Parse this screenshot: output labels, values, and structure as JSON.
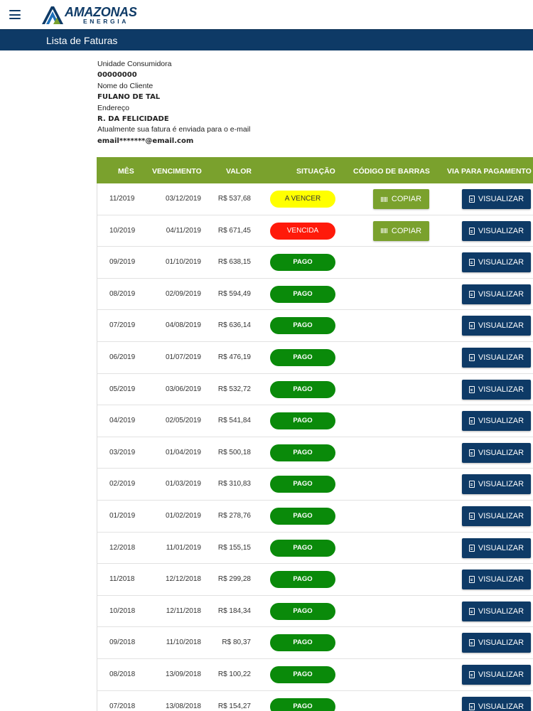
{
  "header": {
    "logo_name": "AMAZONAS",
    "logo_sub": "ENERGIA",
    "page_title": "Lista de Faturas"
  },
  "info": {
    "uc_label": "Unidade Consumidora",
    "uc_value": "00000000",
    "client_label": "Nome do Cliente",
    "client_value": "FULANO DE TAL",
    "address_label": "Endereço",
    "address_value": "R. DA FELICIDADE",
    "email_label": "Atualmente sua fatura é enviada para o e-mail",
    "email_value": "email*******@email.com"
  },
  "table": {
    "headers": {
      "mes": "MÊS",
      "vencimento": "VENCIMENTO",
      "valor": "VALOR",
      "situacao": "SITUAÇÃO",
      "codigo": "CÓDIGO DE BARRAS",
      "via": "VIA PARA PAGAMENTO"
    },
    "copy_label": "COPIAR",
    "view_label": "VISUALIZAR",
    "colors": {
      "header_bg": "#7aa12d",
      "navy": "#0e3a66",
      "paid": "#0a8a0a",
      "due": "#ffff00",
      "overdue": "#ff1a0a"
    },
    "rows": [
      {
        "mes": "11/2019",
        "vencimento": "03/12/2019",
        "valor": "R$ 537,68",
        "situacao": "A VENCER",
        "status": "vencer"
      },
      {
        "mes": "10/2019",
        "vencimento": "04/11/2019",
        "valor": "R$ 671,45",
        "situacao": "VENCIDA",
        "status": "vencida"
      },
      {
        "mes": "09/2019",
        "vencimento": "01/10/2019",
        "valor": "R$ 638,15",
        "situacao": "PAGO",
        "status": "pago"
      },
      {
        "mes": "08/2019",
        "vencimento": "02/09/2019",
        "valor": "R$ 594,49",
        "situacao": "PAGO",
        "status": "pago"
      },
      {
        "mes": "07/2019",
        "vencimento": "04/08/2019",
        "valor": "R$ 636,14",
        "situacao": "PAGO",
        "status": "pago"
      },
      {
        "mes": "06/2019",
        "vencimento": "01/07/2019",
        "valor": "R$ 476,19",
        "situacao": "PAGO",
        "status": "pago"
      },
      {
        "mes": "05/2019",
        "vencimento": "03/06/2019",
        "valor": "R$ 532,72",
        "situacao": "PAGO",
        "status": "pago"
      },
      {
        "mes": "04/2019",
        "vencimento": "02/05/2019",
        "valor": "R$ 541,84",
        "situacao": "PAGO",
        "status": "pago"
      },
      {
        "mes": "03/2019",
        "vencimento": "01/04/2019",
        "valor": "R$ 500,18",
        "situacao": "PAGO",
        "status": "pago"
      },
      {
        "mes": "02/2019",
        "vencimento": "01/03/2019",
        "valor": "R$ 310,83",
        "situacao": "PAGO",
        "status": "pago"
      },
      {
        "mes": "01/2019",
        "vencimento": "01/02/2019",
        "valor": "R$ 278,76",
        "situacao": "PAGO",
        "status": "pago"
      },
      {
        "mes": "12/2018",
        "vencimento": "11/01/2019",
        "valor": "R$ 155,15",
        "situacao": "PAGO",
        "status": "pago"
      },
      {
        "mes": "11/2018",
        "vencimento": "12/12/2018",
        "valor": "R$ 299,28",
        "situacao": "PAGO",
        "status": "pago"
      },
      {
        "mes": "10/2018",
        "vencimento": "12/11/2018",
        "valor": "R$ 184,34",
        "situacao": "PAGO",
        "status": "pago"
      },
      {
        "mes": "09/2018",
        "vencimento": "11/10/2018",
        "valor": "R$ 80,37",
        "situacao": "PAGO",
        "status": "pago"
      },
      {
        "mes": "08/2018",
        "vencimento": "13/09/2018",
        "valor": "R$ 100,22",
        "situacao": "PAGO",
        "status": "pago"
      },
      {
        "mes": "07/2018",
        "vencimento": "13/08/2018",
        "valor": "R$ 154,27",
        "situacao": "PAGO",
        "status": "pago"
      }
    ]
  }
}
